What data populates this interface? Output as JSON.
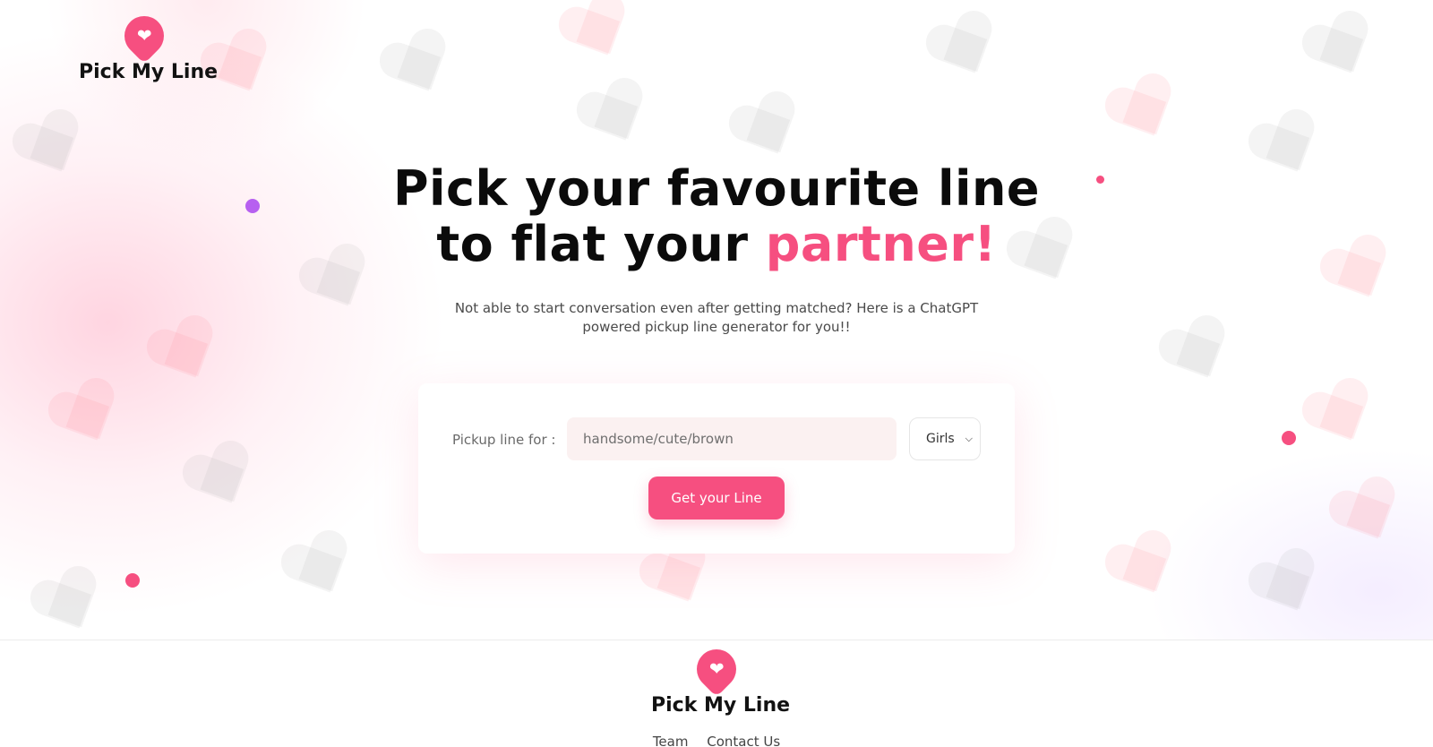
{
  "brand": {
    "name": "Pick My Line",
    "icon": "heart-chat-bubble-icon",
    "color": "#f64f80"
  },
  "hero": {
    "headline_line1": "Pick your favourite line",
    "headline_line2_prefix": "to flat your ",
    "headline_accent": "partner!",
    "subtitle": "Not able to start conversation even after getting matched? Here is a ChatGPT powered pickup line generator for you!!"
  },
  "form": {
    "label": "Pickup line for :",
    "input_placeholder": "handsome/cute/brown",
    "input_value": "",
    "select_value": "Girls",
    "submit_label": "Get your Line"
  },
  "footer": {
    "brand_name": "Pick My Line",
    "links": [
      "Team",
      "Contact Us"
    ]
  },
  "colors": {
    "accent": "#f64f80",
    "dot_purple": "#b760f0",
    "input_bg": "#fbf1f1"
  }
}
